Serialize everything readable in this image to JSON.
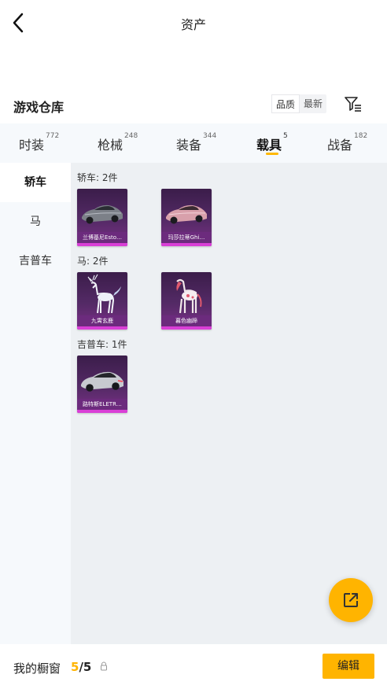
{
  "header": {
    "title": "资产"
  },
  "warehouse": {
    "title": "游戏仓库",
    "sort_options": [
      "品质",
      "最新"
    ]
  },
  "tabs": [
    {
      "label": "时装",
      "count": "772"
    },
    {
      "label": "枪械",
      "count": "248"
    },
    {
      "label": "装备",
      "count": "344"
    },
    {
      "label": "载具",
      "count": "5"
    },
    {
      "label": "战备",
      "count": "182"
    }
  ],
  "sidebar": {
    "items": [
      "轿车",
      "马",
      "吉普车"
    ]
  },
  "groups": [
    {
      "label": "轿车: 2件",
      "items": [
        {
          "name": "兰博基尼Esto…"
        },
        {
          "name": "玛莎拉蒂Ghi…"
        }
      ]
    },
    {
      "label": "马: 2件",
      "items": [
        {
          "name": "九霄玄鹿"
        },
        {
          "name": "暮色幽蹄"
        }
      ]
    },
    {
      "label": "吉普车: 1件",
      "items": [
        {
          "name": "路特斯ELETR…"
        }
      ]
    }
  ],
  "showcase": {
    "label": "我的橱窗",
    "current": "5",
    "separator": "/",
    "total": "5"
  },
  "buttons": {
    "edit": "编辑"
  },
  "colors": {
    "accent": "#ffb400",
    "card_purple": "#542a66",
    "card_bar": "#d93fd6"
  },
  "icons": {
    "back": "back-arrow-icon",
    "filter": "filter-icon",
    "share": "share-external-icon",
    "lock": "lock-icon"
  }
}
